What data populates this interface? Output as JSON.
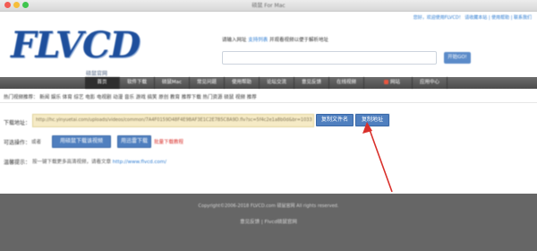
{
  "window": {
    "title": "硕鼠 For Mac"
  },
  "header": {
    "top_links": "您好，欢迎使用FLVCD！ 请收藏本站 | 使用帮助 | 联系我们",
    "logo_text": "FLVCD",
    "logo_sub": "硕鼠官网",
    "hint_prefix": "请输入网址",
    "hint_link": "支持列表",
    "hint_suffix": "并观看视频以便于解析地址",
    "url_input_value": "",
    "start_button": "开始GO!"
  },
  "nav": {
    "items": [
      "首页",
      "软件下载",
      "硕鼠Mac",
      "常见问题",
      "使用帮助",
      "论坛交流",
      "意见反馈",
      "在线视频",
      "网站",
      "应用中心"
    ]
  },
  "content": {
    "hotline": "热门视频推荐： 新闻  娱乐  体育  综艺  电影  电视剧  动漫  音乐  游戏  搞笑  原创  教育  推荐下载  热门资源  硕鼠  视频  推荐",
    "download_label": "下载地址：",
    "download_url": "http://hc.yinyuetai.com/uploads/videos/common/7A4F0159D48F4E9BAF3E1C2E7B5C8A9D.flv?sc=5f4c2e1a8b0d&br=1033",
    "copy_name_button": "复制文件名",
    "copy_address_button": "复制地址",
    "options_label": "可选操作：",
    "options_sub": "或者",
    "option_button_1": "用硕鼠下载该视频",
    "option_button_2": "用迅雷下载",
    "option_red": "批量下载教程",
    "note_label": "温馨提示：",
    "note_text": "按一键下载更多高清视频，请看文章",
    "note_link": "http://www.flvcd.com/"
  },
  "footer": {
    "copyright": "Copyright©2006-2018 FLVCD.com 硕鼠官网 All rights reserved.",
    "links": "意见反馈  |  Flvcd硕鼠官网"
  },
  "colors": {
    "nav_bg": "#555555",
    "footer_bg": "#666666",
    "button_blue": "#4f7fbf",
    "url_field_bg": "#f6ebc6",
    "arrow_red": "#d9302b"
  }
}
